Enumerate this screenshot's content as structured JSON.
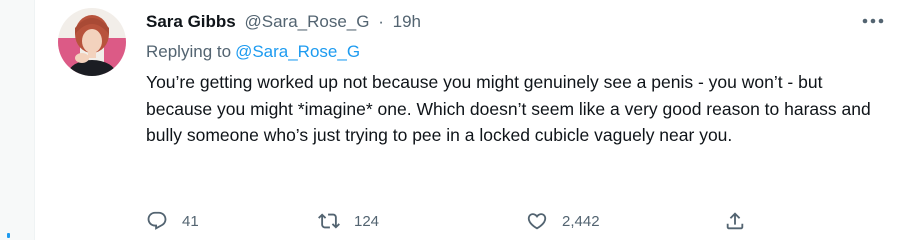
{
  "tweet": {
    "display_name": "Sara Gibbs",
    "handle": "@Sara_Rose_G",
    "separator": "·",
    "timestamp": "19h",
    "replying_prefix": "Replying to",
    "replying_to": "@Sara_Rose_G",
    "text": "You’re getting worked up not because you might genuinely see a penis - you won’t - but because you might *imagine* one. Which doesn’t seem like a very good reason to harass and bully someone who’s just trying to pee in a locked cubicle vaguely near you."
  },
  "actions": {
    "reply_count": "41",
    "retweet_count": "124",
    "like_count": "2,442"
  },
  "icons": {
    "more": "more-icon",
    "reply": "reply-icon",
    "retweet": "retweet-icon",
    "like": "heart-icon",
    "share": "share-icon"
  },
  "colors": {
    "text": "#0f1419",
    "secondary": "#536471",
    "accent": "#1d9bf0"
  }
}
